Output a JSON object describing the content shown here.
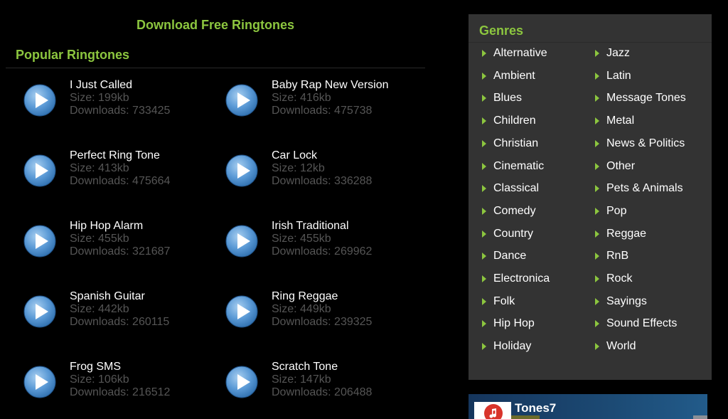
{
  "header": {
    "title": "Download Free Ringtones",
    "section_title": "Popular Ringtones"
  },
  "ringtones": [
    {
      "name": "I Just Called",
      "size": "Size: 199kb",
      "downloads": "Downloads: 733425"
    },
    {
      "name": "Baby Rap New Version",
      "size": "Size: 416kb",
      "downloads": "Downloads: 475738"
    },
    {
      "name": "Perfect Ring Tone",
      "size": "Size: 413kb",
      "downloads": "Downloads: 475664"
    },
    {
      "name": "Car Lock",
      "size": "Size: 12kb",
      "downloads": "Downloads: 336288"
    },
    {
      "name": "Hip Hop Alarm",
      "size": "Size: 455kb",
      "downloads": "Downloads: 321687"
    },
    {
      "name": "Irish Traditional",
      "size": "Size: 455kb",
      "downloads": "Downloads: 269962"
    },
    {
      "name": "Spanish Guitar",
      "size": "Size: 442kb",
      "downloads": "Downloads: 260115"
    },
    {
      "name": "Ring Reggae",
      "size": "Size: 449kb",
      "downloads": "Downloads: 239325"
    },
    {
      "name": "Frog SMS",
      "size": "Size: 106kb",
      "downloads": "Downloads: 216512"
    },
    {
      "name": "Scratch Tone",
      "size": "Size: 147kb",
      "downloads": "Downloads: 206488"
    }
  ],
  "genres": {
    "title": "Genres",
    "left_column": [
      "Alternative",
      "Ambient",
      "Blues",
      "Children",
      "Christian",
      "Cinematic",
      "Classical",
      "Comedy",
      "Country",
      "Dance",
      "Electronica",
      "Folk",
      "Hip Hop",
      "Holiday"
    ],
    "right_column": [
      "Jazz",
      "Latin",
      "Message Tones",
      "Metal",
      "News & Politics",
      "Other",
      "Pets & Animals",
      "Pop",
      "Reggae",
      "RnB",
      "Rock",
      "Sayings",
      "Sound Effects",
      "World"
    ]
  },
  "promo": {
    "title": "Tones7",
    "icon": "music-note-icon"
  },
  "colors": {
    "accent": "#8cc63f",
    "background": "#000000",
    "panel": "#333333",
    "muted_text": "#555555",
    "play_button": "#4a8fd0"
  }
}
